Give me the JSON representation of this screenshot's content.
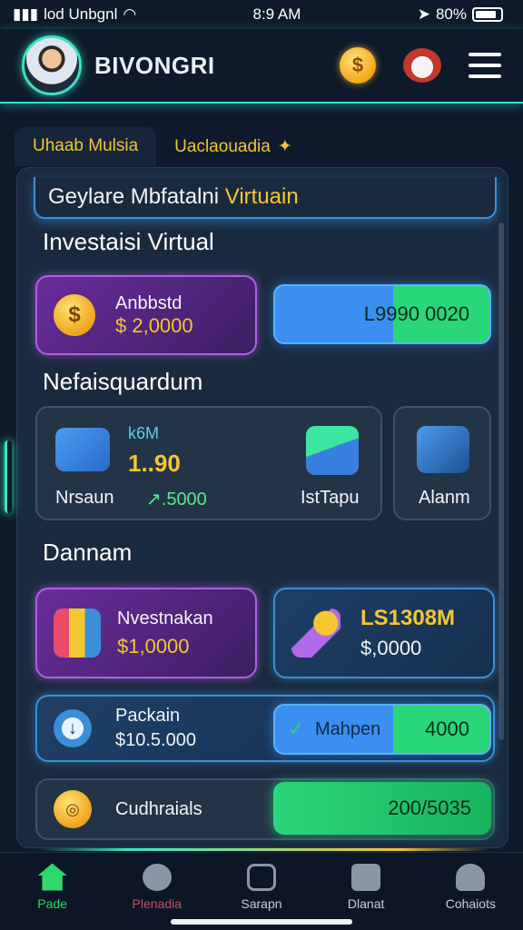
{
  "status": {
    "carrier": "lod Unbgnl",
    "time": "8:9 AM",
    "battery": "80%"
  },
  "header": {
    "brand": "BIVONGRI"
  },
  "tabs": [
    {
      "label": "Uhaab Mulsia"
    },
    {
      "label": "Uaclaouadia"
    }
  ],
  "headline": {
    "text": "Geylare Mbfatalni ",
    "accent": "Virtuain"
  },
  "section1": {
    "title": "Investaisi Virtual",
    "card": {
      "label": "Anbbstd",
      "value": "$ 2,0000"
    },
    "pill": "L9990 0020"
  },
  "section2": {
    "title": "Nefaisquardum",
    "card_main": {
      "top": "k6M",
      "big": "1..90",
      "left": "Nrsaun",
      "right": "↗.5000"
    },
    "card_mid": {
      "label": "IstTapu"
    },
    "card_right": {
      "label": "Alanm"
    }
  },
  "section3": {
    "title": "Dannam",
    "card_left": {
      "label": "Nvestnakan",
      "value": "$1,0000"
    },
    "card_right": {
      "big": "LS1308M",
      "value": "$,0000"
    },
    "row1": {
      "label": "Packain",
      "value": "$10.5.000",
      "pill_label": "Mahpen",
      "pill_value": "4000"
    },
    "row2": {
      "label": "Cudhraials",
      "pill_value": "200/5035"
    }
  },
  "nav": [
    {
      "label": "Pade"
    },
    {
      "label": "Plenadia"
    },
    {
      "label": "Sarapn"
    },
    {
      "label": "Dlanat"
    },
    {
      "label": "Cohaiots"
    }
  ]
}
